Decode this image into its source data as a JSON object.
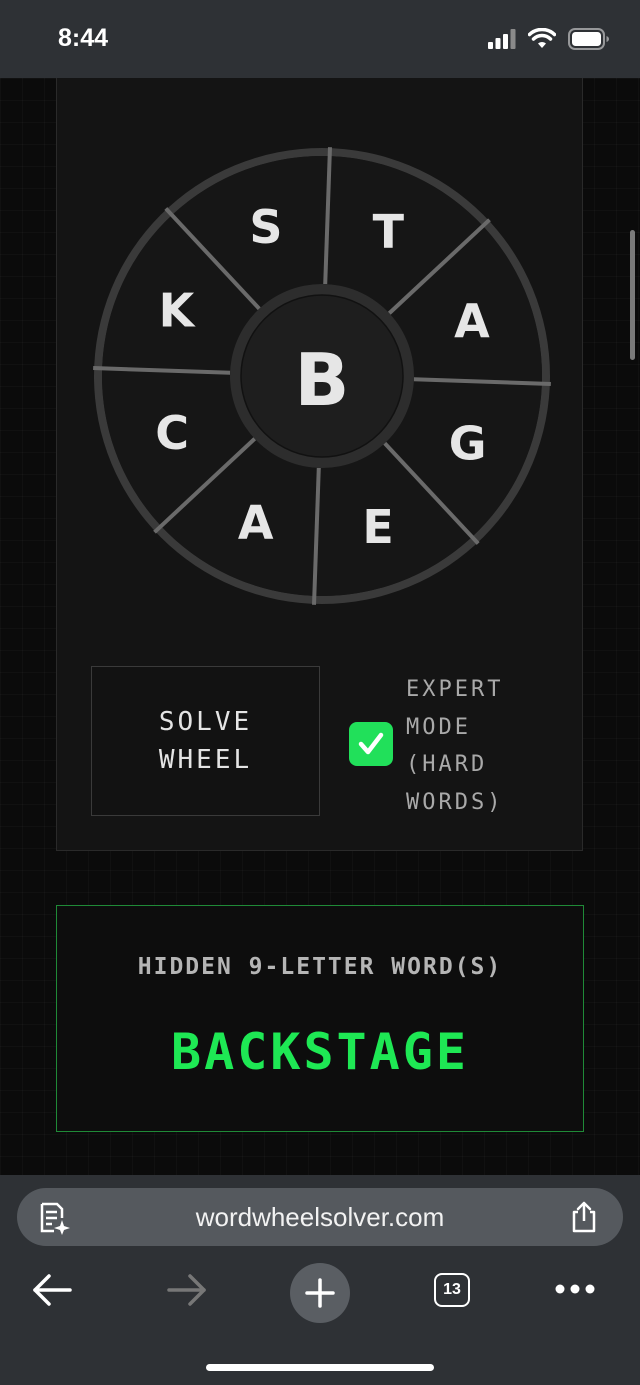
{
  "status_bar": {
    "time": "8:44"
  },
  "wheel": {
    "center_letter": "B",
    "outer_letters": [
      "T",
      "A",
      "G",
      "E",
      "A",
      "C",
      "K",
      "S"
    ]
  },
  "controls": {
    "solve_label": "SOLVE WHEEL",
    "expert_label": "EXPERT MODE (HARD WORDS)",
    "expert_checked": true
  },
  "result": {
    "heading": "HIDDEN 9-LETTER WORD(S)",
    "word": "BACKSTAGE"
  },
  "browser": {
    "url": "wordwheelsolver.com",
    "tab_count": "13"
  },
  "colors": {
    "accent": "#21e05a",
    "result_text": "#1ee854",
    "background": "#0b0b0b"
  }
}
